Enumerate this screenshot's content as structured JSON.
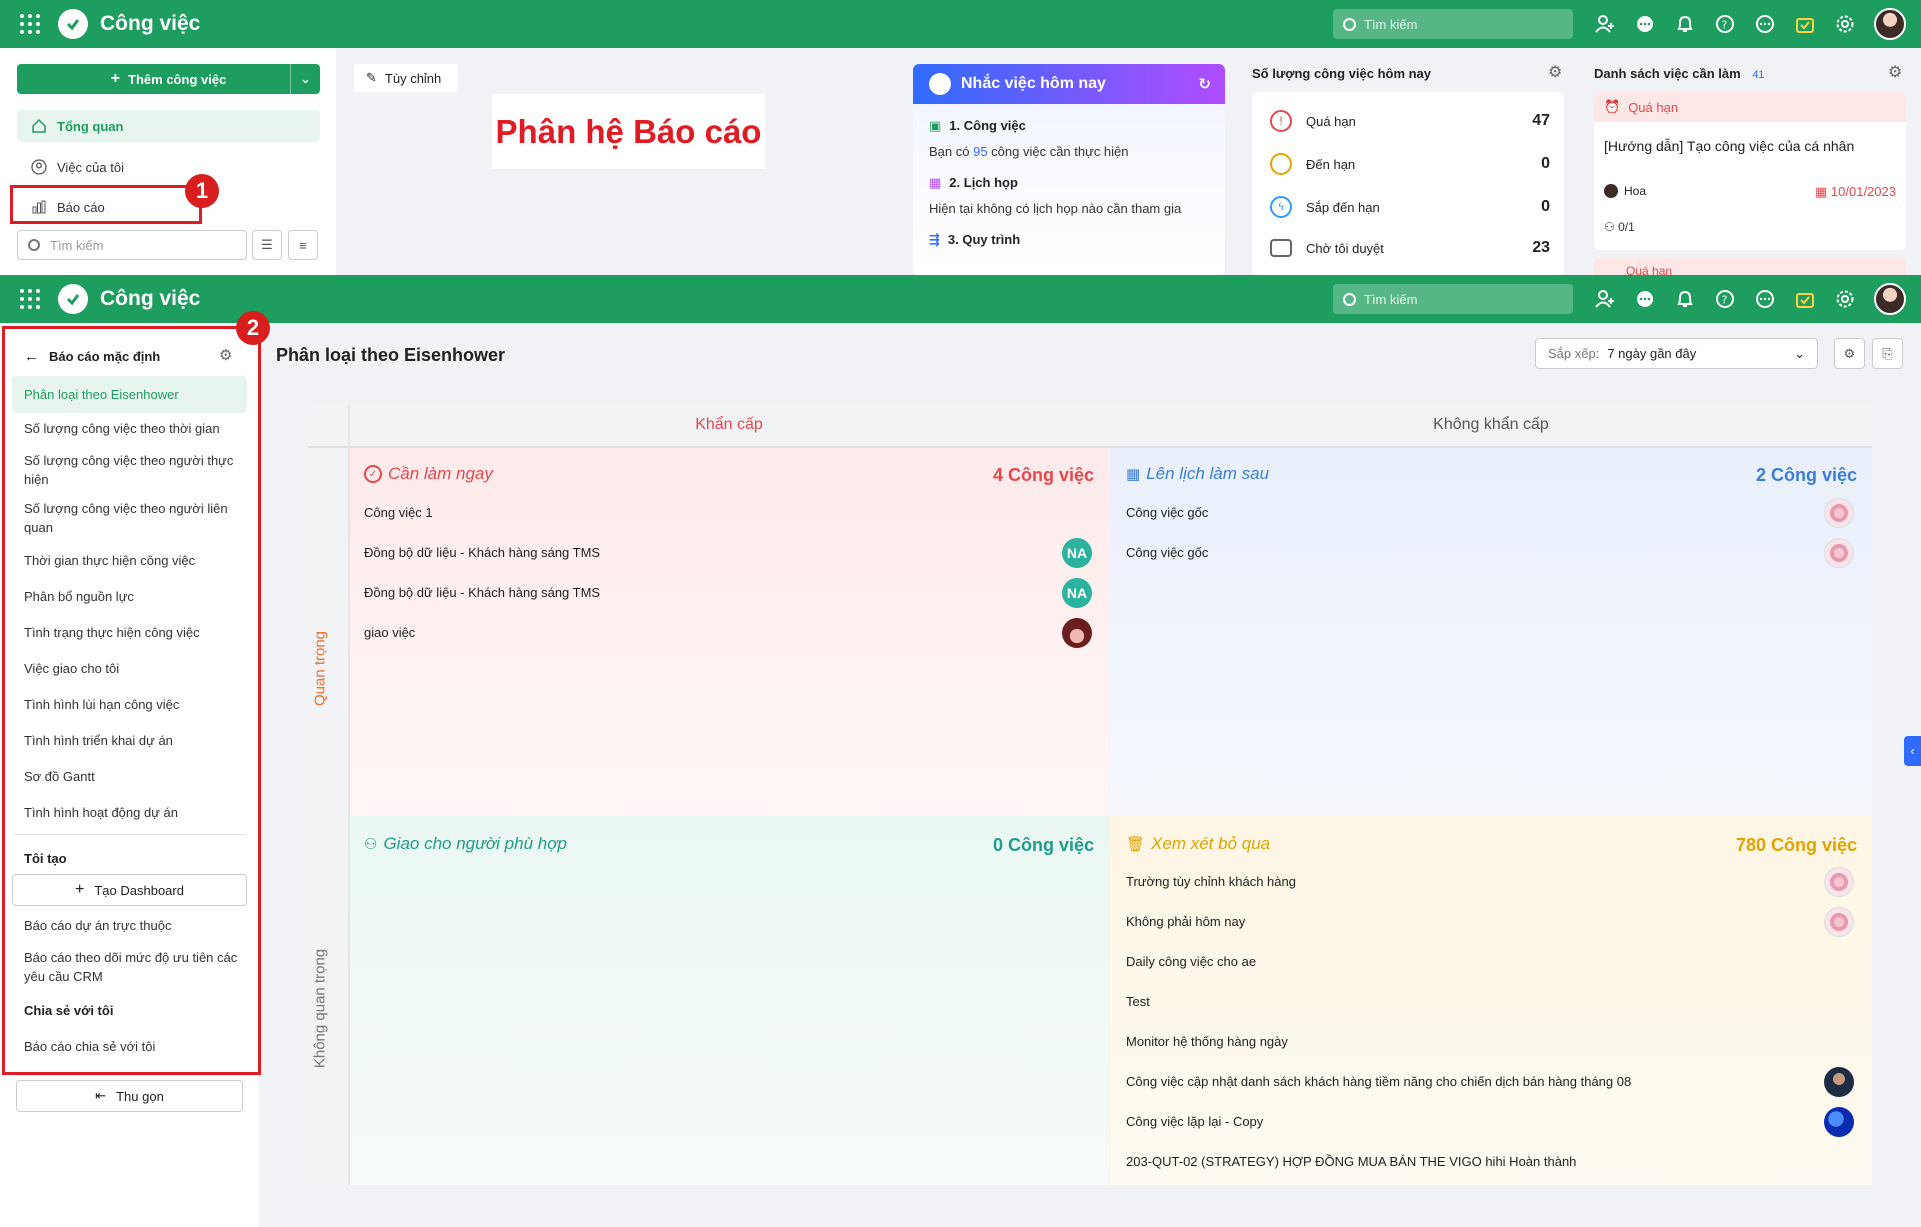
{
  "top1": {
    "app_title": "Công việc",
    "search_placeholder": "Tìm kiếm",
    "add_task_label": "Thêm công việc",
    "customize_label": "Tùy chỉnh",
    "nav": [
      {
        "label": "Tổng quan"
      },
      {
        "label": "Việc của tôi"
      },
      {
        "label": "Báo cáo"
      }
    ],
    "sidebar_search_placeholder": "Tìm kiếm",
    "banner_text": "Phân hệ Báo cáo",
    "step1": "1",
    "reminder": {
      "title": "Nhắc việc hôm nay",
      "items": [
        {
          "heading": "1. Công việc",
          "text_pre": "Bạn có ",
          "count": "95",
          "text_post": " công việc cần thực hiện"
        },
        {
          "heading": "2. Lịch họp",
          "text": "Hiện tại không có lịch họp nào cần tham gia"
        },
        {
          "heading": "3. Quy trình"
        }
      ]
    },
    "counts": {
      "title": "Số lượng công việc hôm nay",
      "rows": [
        {
          "label": "Quá hạn",
          "value": "47"
        },
        {
          "label": "Đến hạn",
          "value": "0"
        },
        {
          "label": "Sắp đến hạn",
          "value": "0"
        },
        {
          "label": "Chờ tôi duyệt",
          "value": "23"
        }
      ]
    },
    "todo": {
      "title": "Danh sách việc cần làm",
      "count": "41",
      "status": "Quá hạn",
      "task_title": "[Hướng dẫn] Tạo công việc của cá nhân",
      "assignee": "Hoa",
      "date": "10/01/2023",
      "progress": "0/1",
      "status2": "Quá hạn"
    }
  },
  "top2": {
    "app_title": "Công việc",
    "search_placeholder": "Tìm kiếm",
    "step2": "2"
  },
  "reports": {
    "back_label": "Báo cáo mặc định",
    "items": [
      "Phân loại theo Eisenhower",
      "Số lượng công việc theo thời gian",
      "Số lượng công việc theo người thực hiện",
      "Số lượng công việc theo người liên quan",
      "Thời gian thực hiện công việc",
      "Phân bổ nguồn lực",
      "Tình trạng thực hiện công việc",
      "Việc giao cho tôi",
      "Tình hình lùi hạn công việc",
      "Tình hình triển khai dự án",
      "Sơ đồ Gantt",
      "Tình hình hoạt động dự án"
    ],
    "mine_heading": "Tôi tạo",
    "create_dashboard": "Tạo Dashboard",
    "mine_items": [
      "Báo cáo dự án trực thuộc",
      "Báo cáo theo dõi mức độ ưu tiên các yêu cầu CRM"
    ],
    "shared_heading": "Chia sẻ với tôi",
    "shared_items": [
      "Báo cáo chia sẻ với tôi"
    ],
    "collapse_label": "Thu gọn"
  },
  "main": {
    "page_title": "Phân loại theo Eisenhower",
    "sort_label": "Sắp xếp:",
    "sort_value": "7 ngày gần đây",
    "col_urgent": "Khẩn cấp",
    "col_not_urgent": "Không khẩn cấp",
    "row_important": "Quan trọng",
    "row_not_important": "Không quan trọng",
    "quadrants": {
      "do_now": {
        "title": "Cần làm ngay",
        "count": "4 Công việc",
        "color": "#e5484d",
        "tasks": [
          {
            "name": "Công việc 1",
            "avatar": ""
          },
          {
            "name": "Đồng bộ dữ liệu - Khách hàng sáng TMS",
            "avatar": "NA"
          },
          {
            "name": "Đồng bộ dữ liệu - Khách hàng sáng TMS",
            "avatar": "NA"
          },
          {
            "name": "giao việc",
            "avatar": "girl"
          }
        ]
      },
      "schedule": {
        "title": "Lên lịch làm sau",
        "count": "2 Công việc",
        "color": "#3b7dd8",
        "tasks": [
          {
            "name": "Công việc gốc",
            "avatar": "flower"
          },
          {
            "name": "Công việc gốc",
            "avatar": "flower"
          }
        ]
      },
      "delegate": {
        "title": "Giao cho người phù hợp",
        "count": "0 Công việc",
        "color": "#1e9e8a",
        "tasks": []
      },
      "eliminate": {
        "title": "Xem xét bỏ qua",
        "count": "780 Công việc",
        "color": "#e3a300",
        "tasks": [
          {
            "name": "Trường tùy chỉnh khách hàng",
            "avatar": "flower"
          },
          {
            "name": "Không phải hôm nay",
            "avatar": "flower"
          },
          {
            "name": "Daily công việc cho ae",
            "avatar": ""
          },
          {
            "name": "Test",
            "avatar": ""
          },
          {
            "name": "Monitor hệ thống hàng ngày",
            "avatar": ""
          },
          {
            "name": "Công việc cập nhật danh sách khách hàng tiềm năng cho chiến dịch bán hàng tháng 08",
            "avatar": "dark"
          },
          {
            "name": "Công việc lặp lại - Copy",
            "avatar": "blue"
          },
          {
            "name": "203-QUT-02 (STRATEGY) HỢP ĐỒNG MUA BÁN THE VIGO hihi Hoàn thành",
            "avatar": ""
          }
        ]
      }
    }
  }
}
